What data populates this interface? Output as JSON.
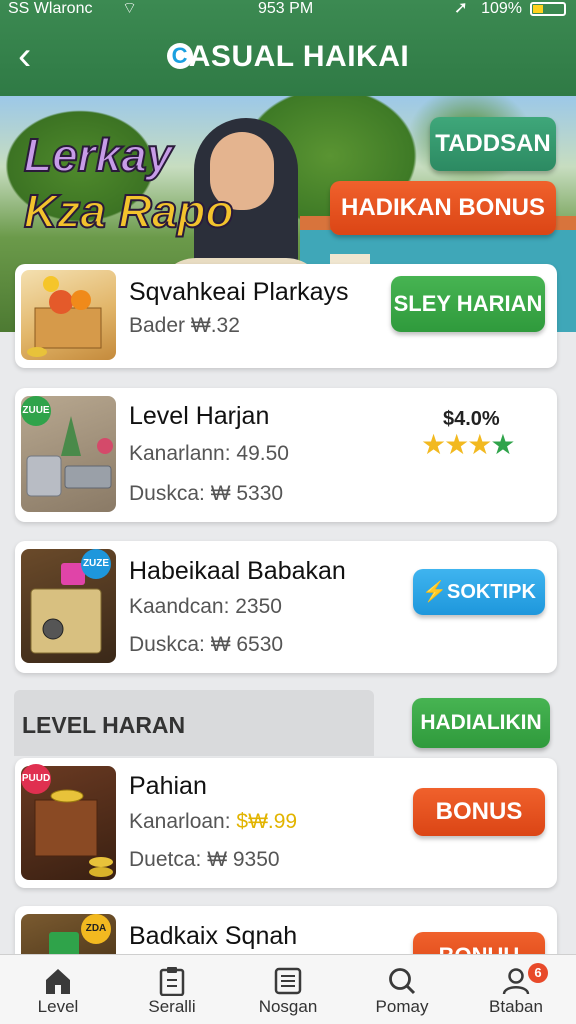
{
  "status_bar": {
    "carrier": "SS Wlaronc",
    "time": "953 PM",
    "battery": "109%"
  },
  "header": {
    "title": "ASUAL HAIKAI",
    "logo_letter": "C",
    "back_icon": "chevron-left-icon"
  },
  "hero": {
    "title_line1": "Lerkay",
    "title_line2": "Kza Rapo",
    "button_top": "TADDSAN",
    "button_bonus": "HADIKAN BONUS"
  },
  "cards": [
    {
      "title": "Sqvahkeai Plarkays",
      "line1": "Bader ₩.32",
      "button": "SLEY HARIAN"
    },
    {
      "title": "Level  Harjan",
      "line1": "Kanarlann: 49.50",
      "line2": "Duskca: ₩ 5330",
      "price": "$4.0%",
      "rating": 4,
      "badge": "ZUUE"
    },
    {
      "title": "Habeikaal Babakan",
      "line1": "Kaandcan: 2350",
      "line2": "Duskca: ₩ 6530",
      "button": "SOKTIPK",
      "badge": "ZUZE"
    },
    {
      "title": "Pahian",
      "line1_prefix": "Kanarloan: ",
      "line1_value": "$₩.99",
      "line2": "Duetca: ₩ 9350",
      "button": "BONUS",
      "badge": "PUUD"
    },
    {
      "title": "Badkaix Sqnah",
      "button": "BONUU",
      "badge": "ZDA"
    }
  ],
  "section": {
    "title": "LEVEL HARAN",
    "button": "HADIALIKIN"
  },
  "bottom_nav": [
    {
      "label": "Level",
      "icon": "home-icon"
    },
    {
      "label": "Seralli",
      "icon": "clipboard-icon"
    },
    {
      "label": "Nosgan",
      "icon": "list-icon"
    },
    {
      "label": "Pomay",
      "icon": "search-icon"
    },
    {
      "label": "Btaban",
      "icon": "user-icon",
      "notification": "6"
    }
  ],
  "colors": {
    "header_green": "#2f7a45",
    "button_green": "#2f9a3c",
    "button_orange": "#db4515",
    "button_blue": "#1e97dc"
  }
}
